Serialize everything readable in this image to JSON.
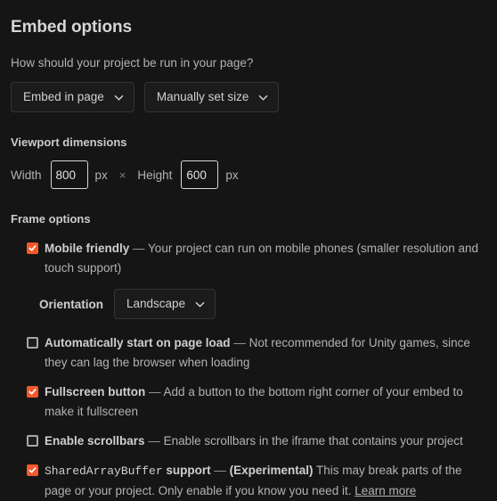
{
  "header": {
    "title": "Embed options"
  },
  "run_question": {
    "text": "How should your project be run in your page?",
    "embed_mode": {
      "value": "Embed in page",
      "icon": "chevron-down-icon"
    },
    "size_mode": {
      "value": "Manually set size",
      "icon": "chevron-down-icon"
    }
  },
  "viewport": {
    "section_label": "Viewport dimensions",
    "width_label": "Width",
    "width_value": "800",
    "width_unit": "px",
    "separator": "×",
    "height_label": "Height",
    "height_value": "600",
    "height_unit": "px"
  },
  "frame": {
    "section_label": "Frame options",
    "options": [
      {
        "name": "mobile-friendly",
        "checked": true,
        "label": "Mobile friendly",
        "dash": "—",
        "description": "Your project can run on mobile phones (smaller resolution and touch support)"
      },
      {
        "name": "auto-start",
        "checked": false,
        "label": "Automatically start on page load",
        "dash": "—",
        "description": "Not recommended for Unity games, since they can lag the browser when loading"
      },
      {
        "name": "fullscreen-button",
        "checked": true,
        "label": "Fullscreen button",
        "dash": "—",
        "description": "Add a button to the bottom right corner of your embed to make it fullscreen"
      },
      {
        "name": "enable-scrollbars",
        "checked": false,
        "label": "Enable scrollbars",
        "dash": "—",
        "description": "Enable scrollbars in the iframe that contains your project"
      },
      {
        "name": "sharedarraybuffer",
        "checked": true,
        "label_mono": "SharedArrayBuffer",
        "label": "support",
        "dash": "—",
        "experimental": "(Experimental)",
        "description": "This may break parts of the page or your project. Only enable if you know you need it.",
        "link": "Learn more"
      }
    ],
    "orientation": {
      "label": "Orientation",
      "value": "Landscape",
      "icon": "chevron-down-icon"
    }
  },
  "colors": {
    "background": "#151515",
    "accent": "#f2592a",
    "text": "#b2b2b3",
    "heading": "#d6d6d7"
  }
}
